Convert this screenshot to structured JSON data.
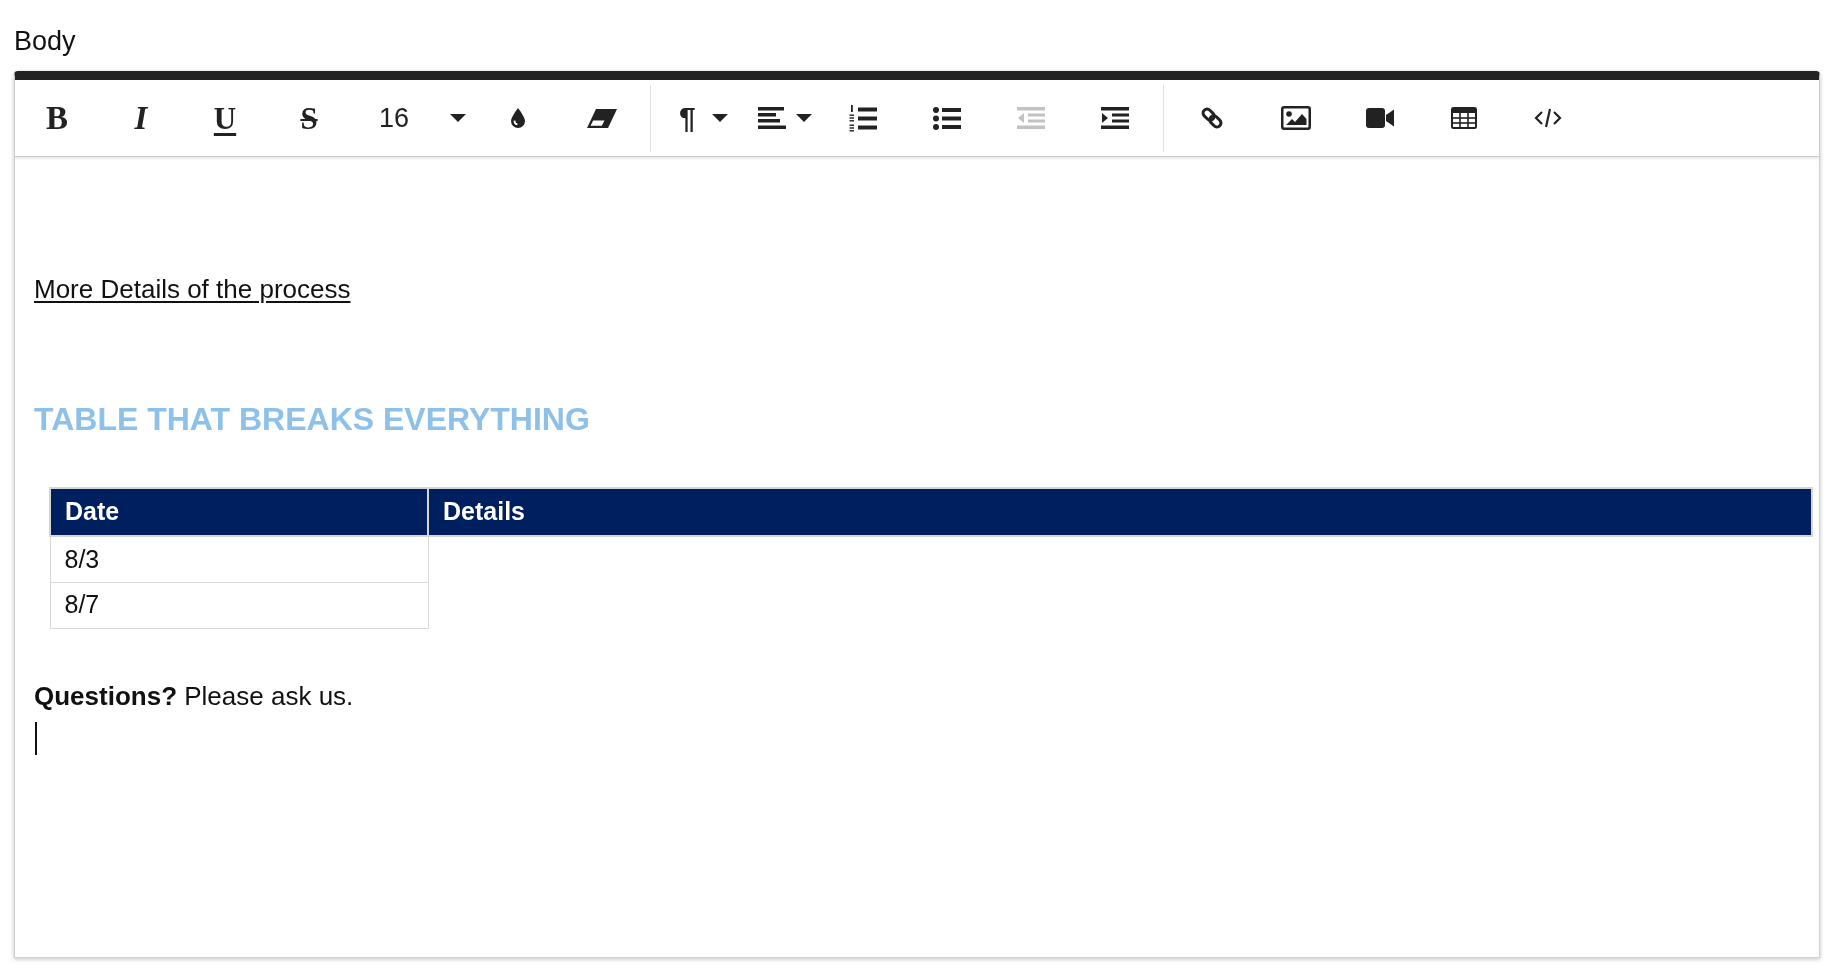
{
  "field_label": "Body",
  "toolbar": {
    "groups": [
      [
        {
          "kind": "bold",
          "glyph": "B",
          "disabled": false
        },
        {
          "kind": "italic",
          "glyph": "I",
          "disabled": false
        },
        {
          "kind": "underline",
          "glyph": "U",
          "disabled": false
        },
        {
          "kind": "strikethrough",
          "glyph": "S",
          "disabled": false
        },
        {
          "kind": "font_size",
          "value": "16",
          "disabled": false
        },
        {
          "kind": "text_color",
          "disabled": false
        },
        {
          "kind": "clear_format",
          "disabled": false
        }
      ],
      [
        {
          "kind": "paragraph_style",
          "glyph": "¶",
          "disabled": false
        },
        {
          "kind": "align",
          "disabled": false
        },
        {
          "kind": "numbered_list",
          "disabled": false
        },
        {
          "kind": "bullet_list",
          "disabled": false
        },
        {
          "kind": "outdent",
          "disabled": true
        },
        {
          "kind": "indent",
          "disabled": false
        }
      ],
      [
        {
          "kind": "link",
          "disabled": false
        },
        {
          "kind": "image",
          "disabled": false
        },
        {
          "kind": "video",
          "disabled": false
        },
        {
          "kind": "table",
          "disabled": false
        },
        {
          "kind": "code_view",
          "disabled": false
        }
      ]
    ]
  },
  "content": [
    {
      "kind": "link",
      "text": "More Details of the process"
    },
    {
      "kind": "heading",
      "text": "TABLE THAT BREAKS EVERYTHING"
    },
    {
      "kind": "table",
      "columns": [
        "Date",
        "Details"
      ],
      "rows": [
        [
          "8/3"
        ],
        [
          "8/7"
        ]
      ]
    },
    {
      "kind": "paragraph",
      "text": "**Questions?** Please ask us."
    },
    {
      "kind": "cursor"
    }
  ]
}
